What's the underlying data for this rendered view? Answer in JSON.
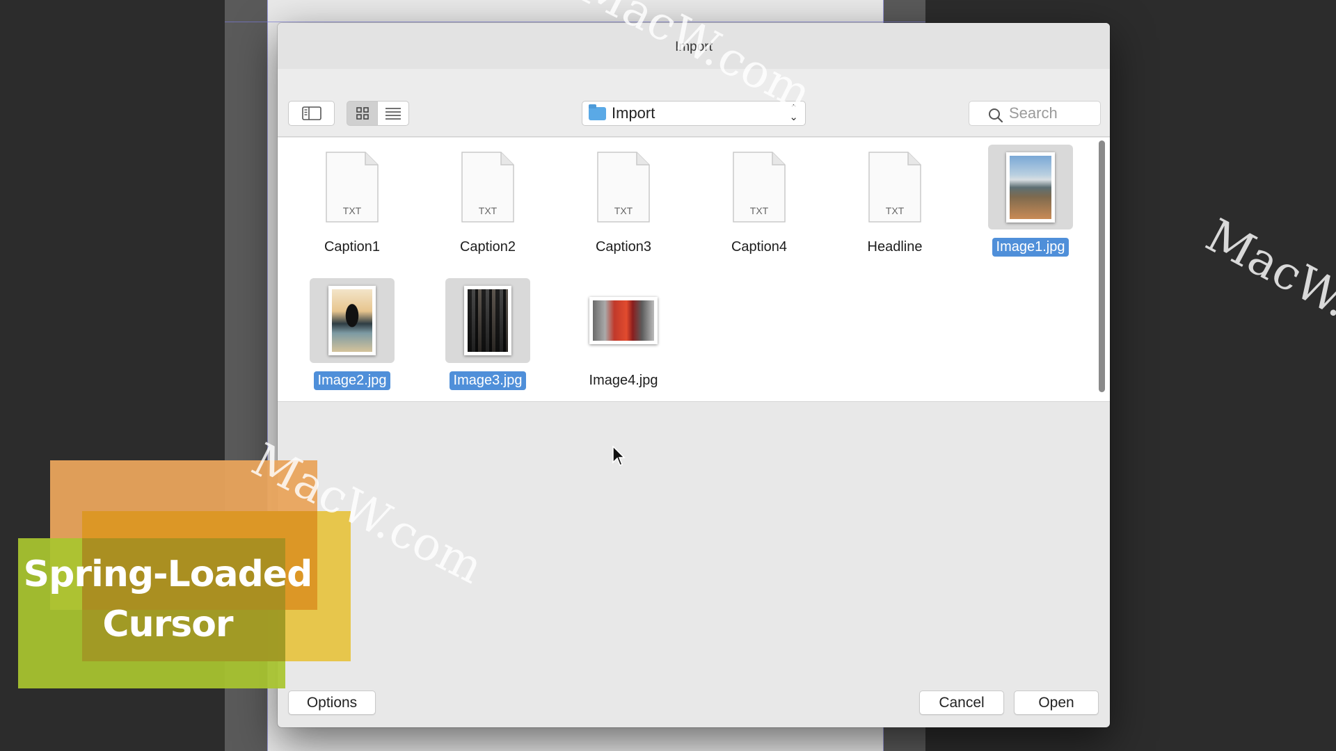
{
  "dialog": {
    "title": "Import",
    "toolbar": {
      "location": "Import",
      "search_placeholder": "Search"
    },
    "files": [
      {
        "name": "Caption1",
        "type": "TXT",
        "selected": false
      },
      {
        "name": "Caption2",
        "type": "TXT",
        "selected": false
      },
      {
        "name": "Caption3",
        "type": "TXT",
        "selected": false
      },
      {
        "name": "Caption4",
        "type": "TXT",
        "selected": false
      },
      {
        "name": "Headline",
        "type": "TXT",
        "selected": false
      },
      {
        "name": "Image1.jpg",
        "type": "image",
        "selected": true
      },
      {
        "name": "Image2.jpg",
        "type": "image",
        "selected": true
      },
      {
        "name": "Image3.jpg",
        "type": "image",
        "selected": true
      },
      {
        "name": "Image4.jpg",
        "type": "image",
        "selected": false
      }
    ],
    "buttons": {
      "options": "Options",
      "cancel": "Cancel",
      "open": "Open"
    }
  },
  "overlay": {
    "line1": "Spring-Loaded",
    "line2": "Cursor"
  },
  "watermark": "MacW.com",
  "colors": {
    "selection": "#4f8fd9",
    "folder": "#5aa9e6"
  }
}
